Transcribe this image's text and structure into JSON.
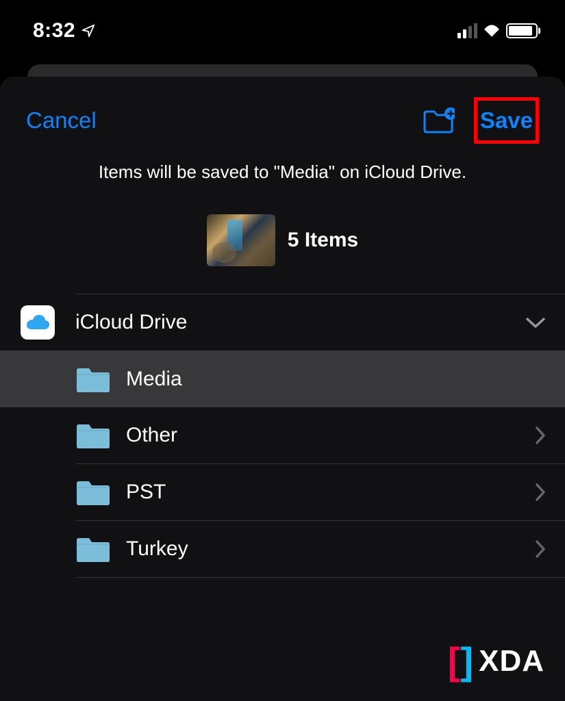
{
  "status_bar": {
    "time": "8:32"
  },
  "nav": {
    "cancel_label": "Cancel",
    "save_label": "Save"
  },
  "info": {
    "message": "Items will be saved to \"Media\" on iCloud Drive.",
    "item_count": "5 Items"
  },
  "drive": {
    "root_label": "iCloud Drive",
    "folders": [
      {
        "name": "Media",
        "selected": true
      },
      {
        "name": "Other",
        "selected": false
      },
      {
        "name": "PST",
        "selected": false
      },
      {
        "name": "Turkey",
        "selected": false
      }
    ]
  },
  "watermark": {
    "text": "XDA"
  },
  "colors": {
    "accent": "#0a84ff",
    "highlight": "#ff0000"
  }
}
